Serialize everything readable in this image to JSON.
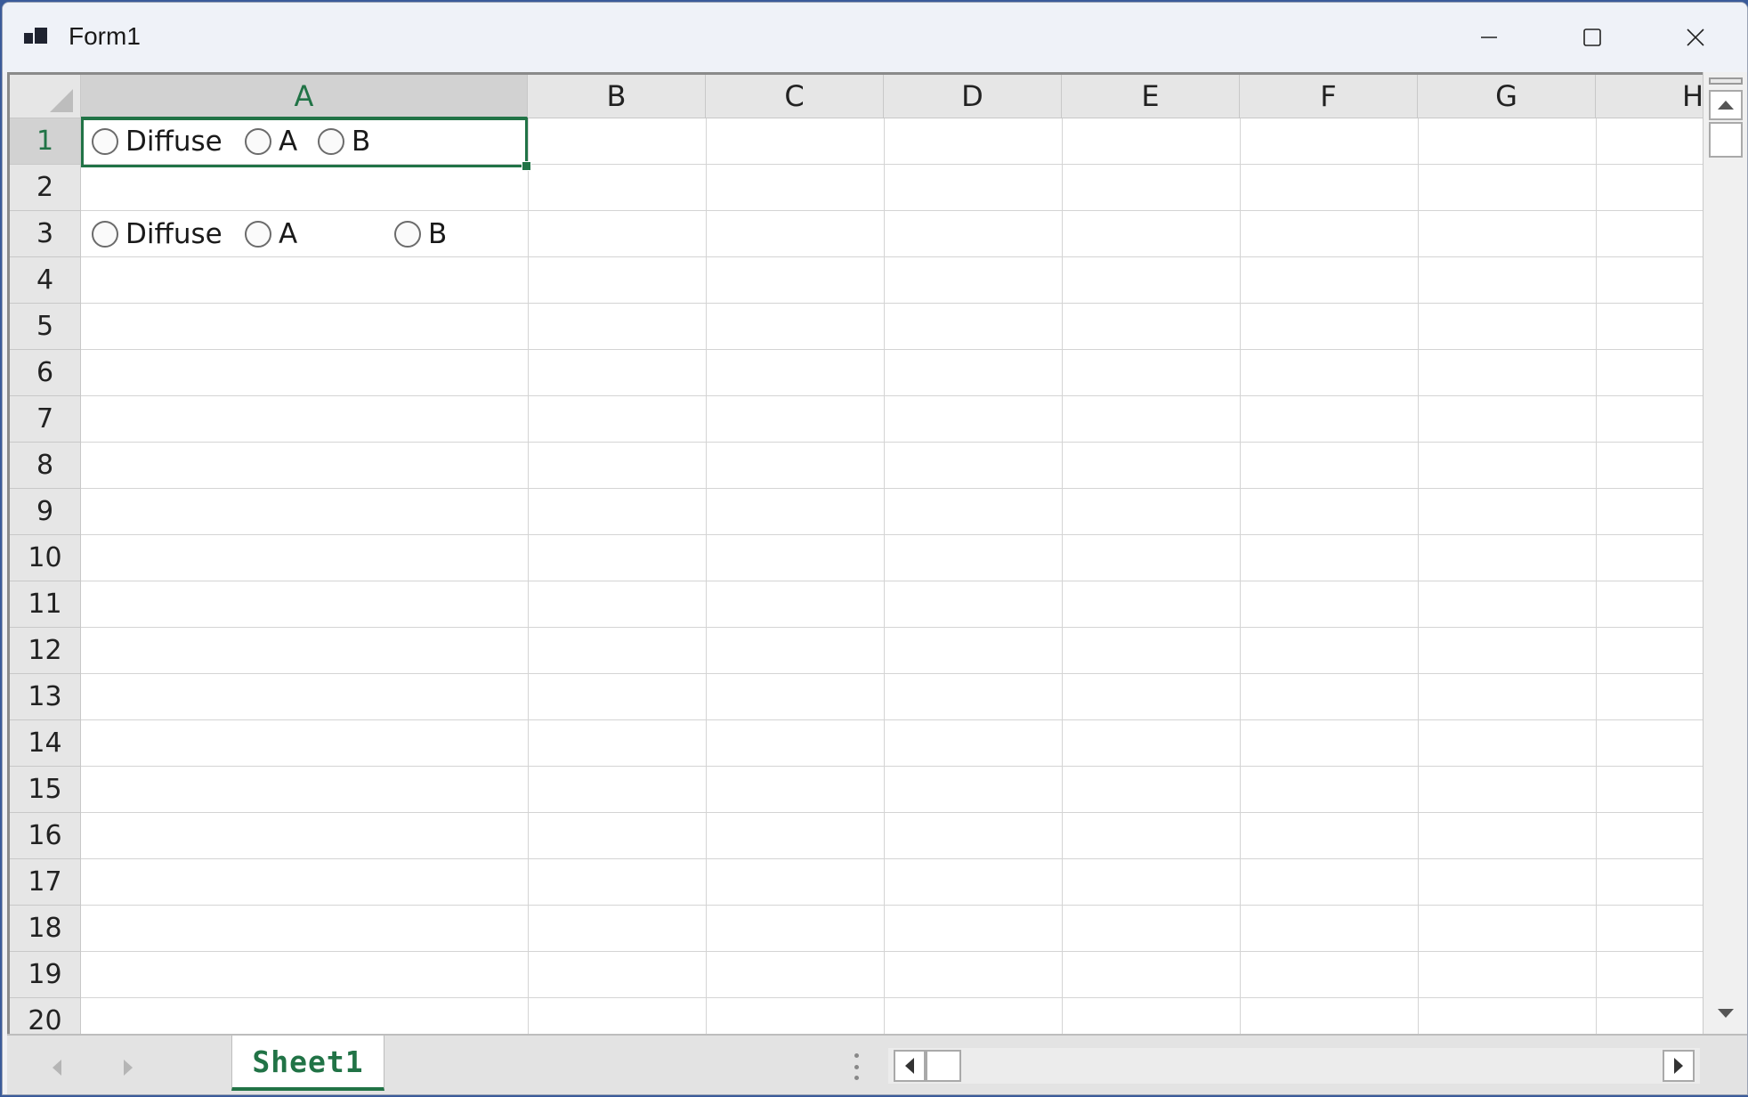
{
  "window": {
    "title": "Form1"
  },
  "columns": [
    "A",
    "B",
    "C",
    "D",
    "E",
    "F",
    "G",
    "H"
  ],
  "selected_column": "A",
  "rows": [
    "1",
    "2",
    "3",
    "4",
    "5",
    "6",
    "7",
    "8",
    "9",
    "10",
    "11",
    "12",
    "13",
    "14",
    "15",
    "16",
    "17",
    "18",
    "19",
    "20"
  ],
  "selected_row": "1",
  "active_cell": "A1",
  "cells": {
    "row1": {
      "radio_options": [
        "Diffuse",
        "A",
        "B"
      ]
    },
    "row3": {
      "radio_options": [
        "Diffuse",
        "A",
        "B"
      ]
    }
  },
  "sheet_tabs": [
    "Sheet1"
  ],
  "active_sheet": "Sheet1",
  "colors": {
    "accent": "#217346",
    "header_bg": "#e6e6e6",
    "gridline": "#d4d4d4"
  }
}
